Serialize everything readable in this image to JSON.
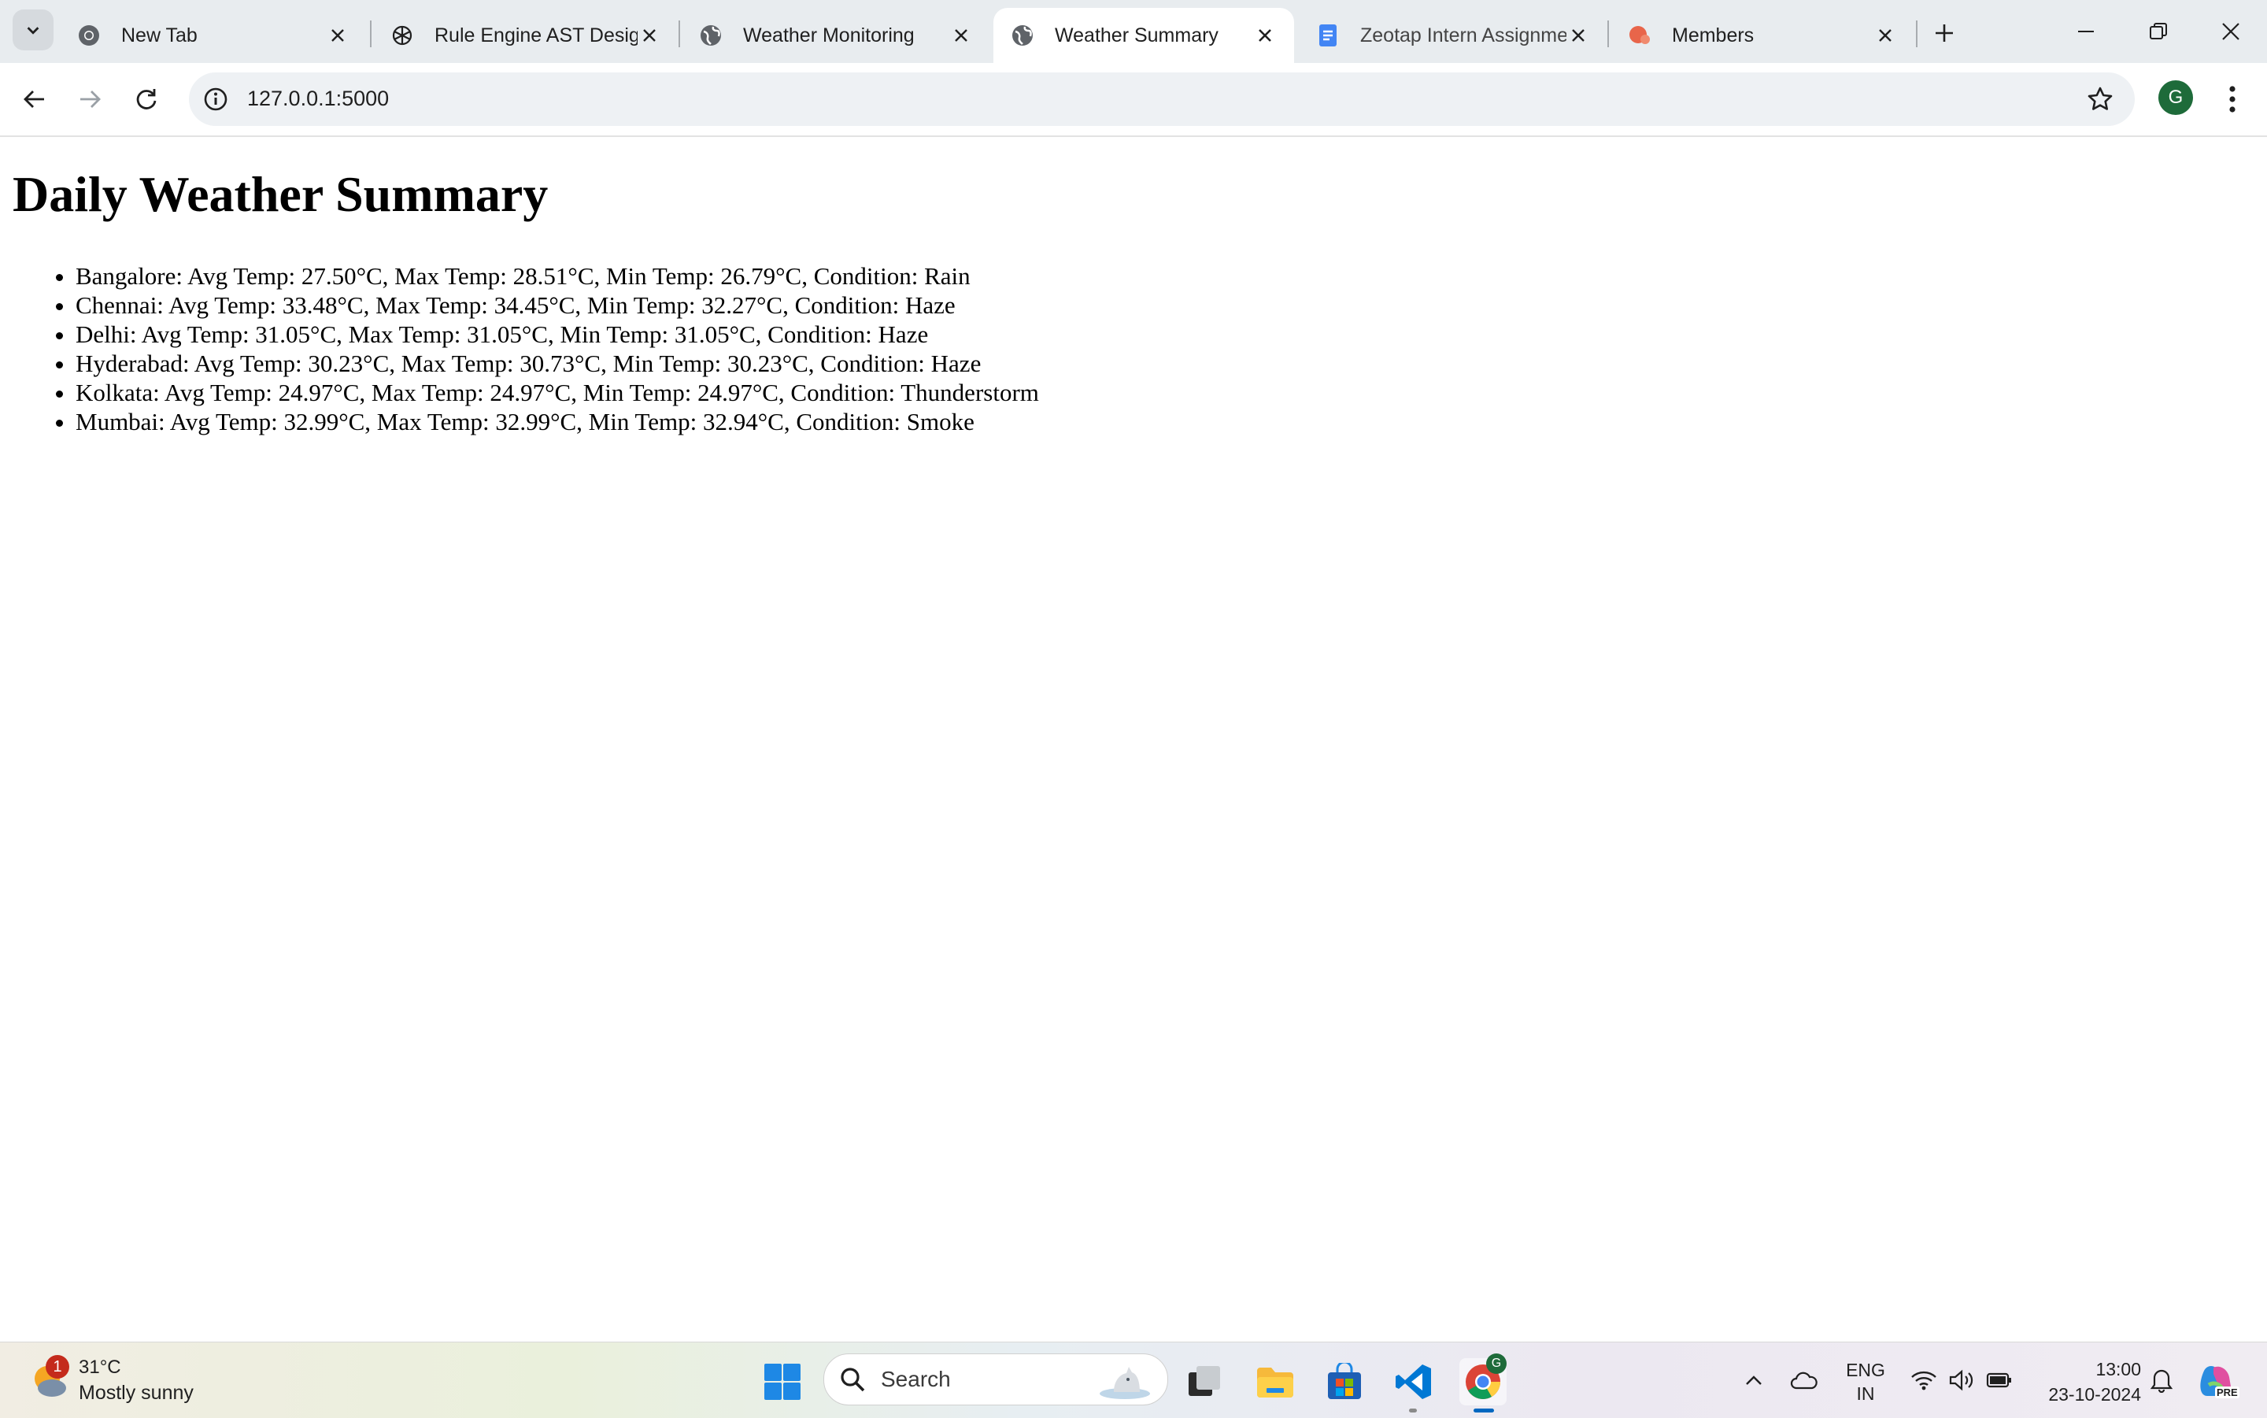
{
  "browser": {
    "tabs": [
      {
        "title": "New Tab",
        "favicon": "chrome-icon",
        "active": false
      },
      {
        "title": "Rule Engine AST Design",
        "favicon": "openai-icon",
        "active": false
      },
      {
        "title": "Weather Monitoring",
        "favicon": "globe-icon",
        "active": false
      },
      {
        "title": "Weather Summary",
        "favicon": "globe-icon",
        "active": true
      },
      {
        "title": "Zeotap Intern Assignme",
        "favicon": "google-docs-icon",
        "active": false
      },
      {
        "title": "Members",
        "favicon": "app-icon",
        "active": false
      }
    ],
    "address": "127.0.0.1:5000",
    "profile_initial": "G"
  },
  "page": {
    "heading": "Daily Weather Summary",
    "items": [
      "Bangalore: Avg Temp: 27.50°C, Max Temp: 28.51°C, Min Temp: 26.79°C, Condition: Rain",
      "Chennai: Avg Temp: 33.48°C, Max Temp: 34.45°C, Min Temp: 32.27°C, Condition: Haze",
      "Delhi: Avg Temp: 31.05°C, Max Temp: 31.05°C, Min Temp: 31.05°C, Condition: Haze",
      "Hyderabad: Avg Temp: 30.23°C, Max Temp: 30.73°C, Min Temp: 30.23°C, Condition: Haze",
      "Kolkata: Avg Temp: 24.97°C, Max Temp: 24.97°C, Min Temp: 24.97°C, Condition: Thunderstorm",
      "Mumbai: Avg Temp: 32.99°C, Max Temp: 32.99°C, Min Temp: 32.94°C, Condition: Smoke"
    ]
  },
  "taskbar": {
    "weather_temp": "31°C",
    "weather_condition": "Mostly sunny",
    "weather_badge": "1",
    "search_label": "Search",
    "chrome_badge": "G",
    "lang_line1": "ENG",
    "lang_line2": "IN",
    "time": "13:00",
    "date": "23-10-2024",
    "copilot_label": "PRE"
  },
  "colors": {
    "accent": "#0067c0",
    "active_tab": "#ffffff",
    "tabstrip": "#e8ecef",
    "profile": "#1e6b3a"
  }
}
